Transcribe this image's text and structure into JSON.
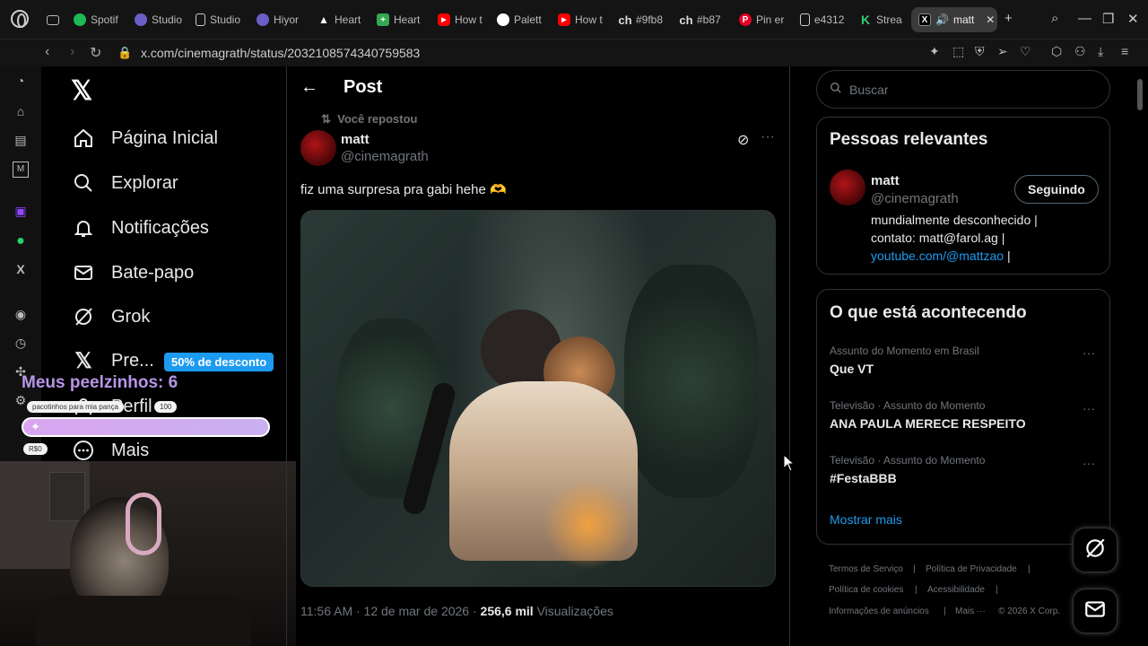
{
  "browser": {
    "tabs": [
      {
        "label": "Spotif",
        "icon": "spotify-icon",
        "color": "#1db954"
      },
      {
        "label": "Studio",
        "icon": "studio-icon",
        "color": "#6b5fc7"
      },
      {
        "label": "Studio",
        "icon": "doc-icon",
        "color": "#888888"
      },
      {
        "label": "Hiyor",
        "icon": "studio-icon",
        "color": "#6b5fc7"
      },
      {
        "label": "Heart",
        "icon": "app-icon",
        "color": "#dddddd"
      },
      {
        "label": "Heart",
        "icon": "sheets-icon",
        "color": "#34a853"
      },
      {
        "label": "How t",
        "icon": "youtube-icon",
        "color": "#ff0000"
      },
      {
        "label": "Palett",
        "icon": "circle-icon",
        "color": "#ffffff"
      },
      {
        "label": "How t",
        "icon": "youtube-icon",
        "color": "#ff0000"
      },
      {
        "label": "#9fb8",
        "icon": "hash-icon",
        "color": "#dddddd"
      },
      {
        "label": "#b87",
        "icon": "hash-icon",
        "color": "#dddddd"
      },
      {
        "label": "Pin er",
        "icon": "pinterest-icon",
        "color": "#e60023"
      },
      {
        "label": "e4312",
        "icon": "doc-icon",
        "color": "#888888"
      },
      {
        "label": "Strea",
        "icon": "streamelements-icon",
        "color": "#2ecc71"
      },
      {
        "label": "matt",
        "icon": "x-icon",
        "color": "#ffffff",
        "active": true
      }
    ],
    "url": "x.com/cinemagrath/status/2032108574340759583"
  },
  "nav": {
    "items": [
      {
        "label": "Página Inicial",
        "icon": "home-icon"
      },
      {
        "label": "Explorar",
        "icon": "search-icon"
      },
      {
        "label": "Notificações",
        "icon": "bell-icon"
      },
      {
        "label": "Bate-papo",
        "icon": "mail-icon"
      },
      {
        "label": "Grok",
        "icon": "grok-icon"
      },
      {
        "label": "Pre...",
        "icon": "x-premium-icon"
      },
      {
        "label": "Perfil",
        "icon": "person-icon"
      },
      {
        "label": "Mais",
        "icon": "more-icon"
      }
    ],
    "promo": "50% de desconto"
  },
  "overlay": {
    "title": "Meus peelzinhos: 6",
    "goal_label": "pacotinhos para mia pança",
    "goal_target": "100",
    "current": "R$0"
  },
  "post": {
    "header": "Post",
    "repost_label": "Você repostou",
    "author_name": "matt",
    "author_handle": "@cinemagrath",
    "text": "fiz uma surpresa pra gabi hehe 🫶",
    "time": "11:56 AM · 12 de mar de 2026 · ",
    "views_count": "256,6 mil",
    "views_label": " Visualizações"
  },
  "right": {
    "search_placeholder": "Buscar",
    "relevant": {
      "title": "Pessoas relevantes",
      "name": "matt",
      "handle": "@cinemagrath",
      "follow_label": "Seguindo",
      "bio_line1": "mundialmente desconhecido |",
      "bio_line2": "contato: matt@farol.ag |",
      "bio_link": "youtube.com/@mattzao",
      "bio_end": " |"
    },
    "trends": {
      "title": "O que está acontecendo",
      "items": [
        {
          "context": "Assunto do Momento em Brasil",
          "title": "Que VT"
        },
        {
          "context": "Televisão · Assunto do Momento",
          "title": "ANA PAULA MERECE RESPEITO"
        },
        {
          "context": "Televisão · Assunto do Momento",
          "title": "#FestaBBB"
        }
      ],
      "show_more": "Mostrar mais"
    },
    "footer": {
      "terms": "Termos de Serviço",
      "privacy": "Política de Privacidade",
      "cookies": "Política de cookies",
      "accessibility": "Acessibilidade",
      "ads": "Informações de anúncios",
      "more": "Mais ···",
      "copyright": "© 2026 X Corp."
    }
  }
}
